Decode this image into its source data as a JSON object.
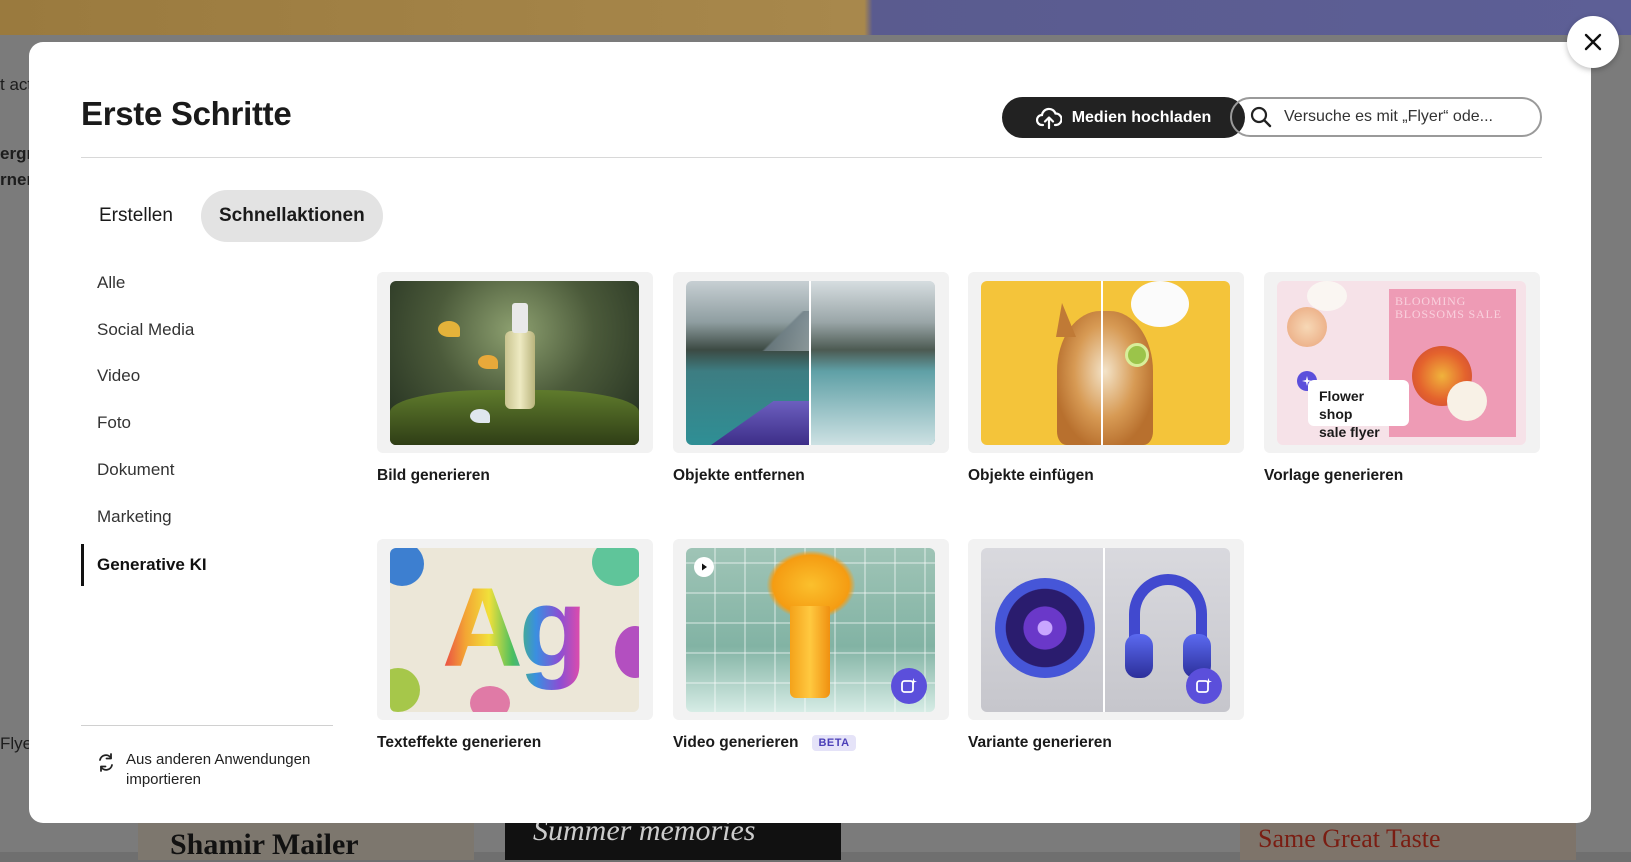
{
  "background": {
    "text_top": "t act",
    "text_left_1": "ergru",
    "text_left_2": "rner",
    "text_left_3": "Flyer",
    "card_a_text": "Shamir Mailer",
    "card_b_text": "Summer memories",
    "card_c_text": "Same Great Taste"
  },
  "modal": {
    "title": "Erste Schritte",
    "upload_label": "Medien hochladen",
    "search_placeholder": "Versuche es mit „Flyer“ ode..."
  },
  "tabs": [
    {
      "label": "Erstellen",
      "active": false
    },
    {
      "label": "Schnellaktionen",
      "active": true
    }
  ],
  "sidebar": {
    "items": [
      {
        "label": "Alle"
      },
      {
        "label": "Social Media"
      },
      {
        "label": "Video"
      },
      {
        "label": "Foto"
      },
      {
        "label": "Dokument"
      },
      {
        "label": "Marketing"
      },
      {
        "label": "Generative KI",
        "active": true
      }
    ],
    "import_label": "Aus anderen Anwendungen importieren"
  },
  "cards": [
    {
      "label": "Bild generieren",
      "image": "serum-bottle-forest-butterflies"
    },
    {
      "label": "Objekte entfernen",
      "image": "mountain-lake-kayak-before-after"
    },
    {
      "label": "Objekte einfügen",
      "image": "shiba-dog-cucumber-mask"
    },
    {
      "label": "Vorlage generieren",
      "image": "flower-shop-flyer",
      "tag_line_1": "Flower shop",
      "tag_line_2": "sale flyer",
      "poster_text": "BLOOMING BLOSSOMS SALE"
    },
    {
      "label": "Texteffekte generieren",
      "image": "rainbow-yarn-letters",
      "letters": "Ag"
    },
    {
      "label": "Video generieren",
      "badge": "BETA",
      "image": "juice-splash-tiles"
    },
    {
      "label": "Variante generieren",
      "image": "vinyl-and-headphones"
    }
  ],
  "colors": {
    "accent_purple": "#5b4fdb",
    "dark_button": "#222222",
    "active_tab_bg": "#e3e3e3"
  }
}
